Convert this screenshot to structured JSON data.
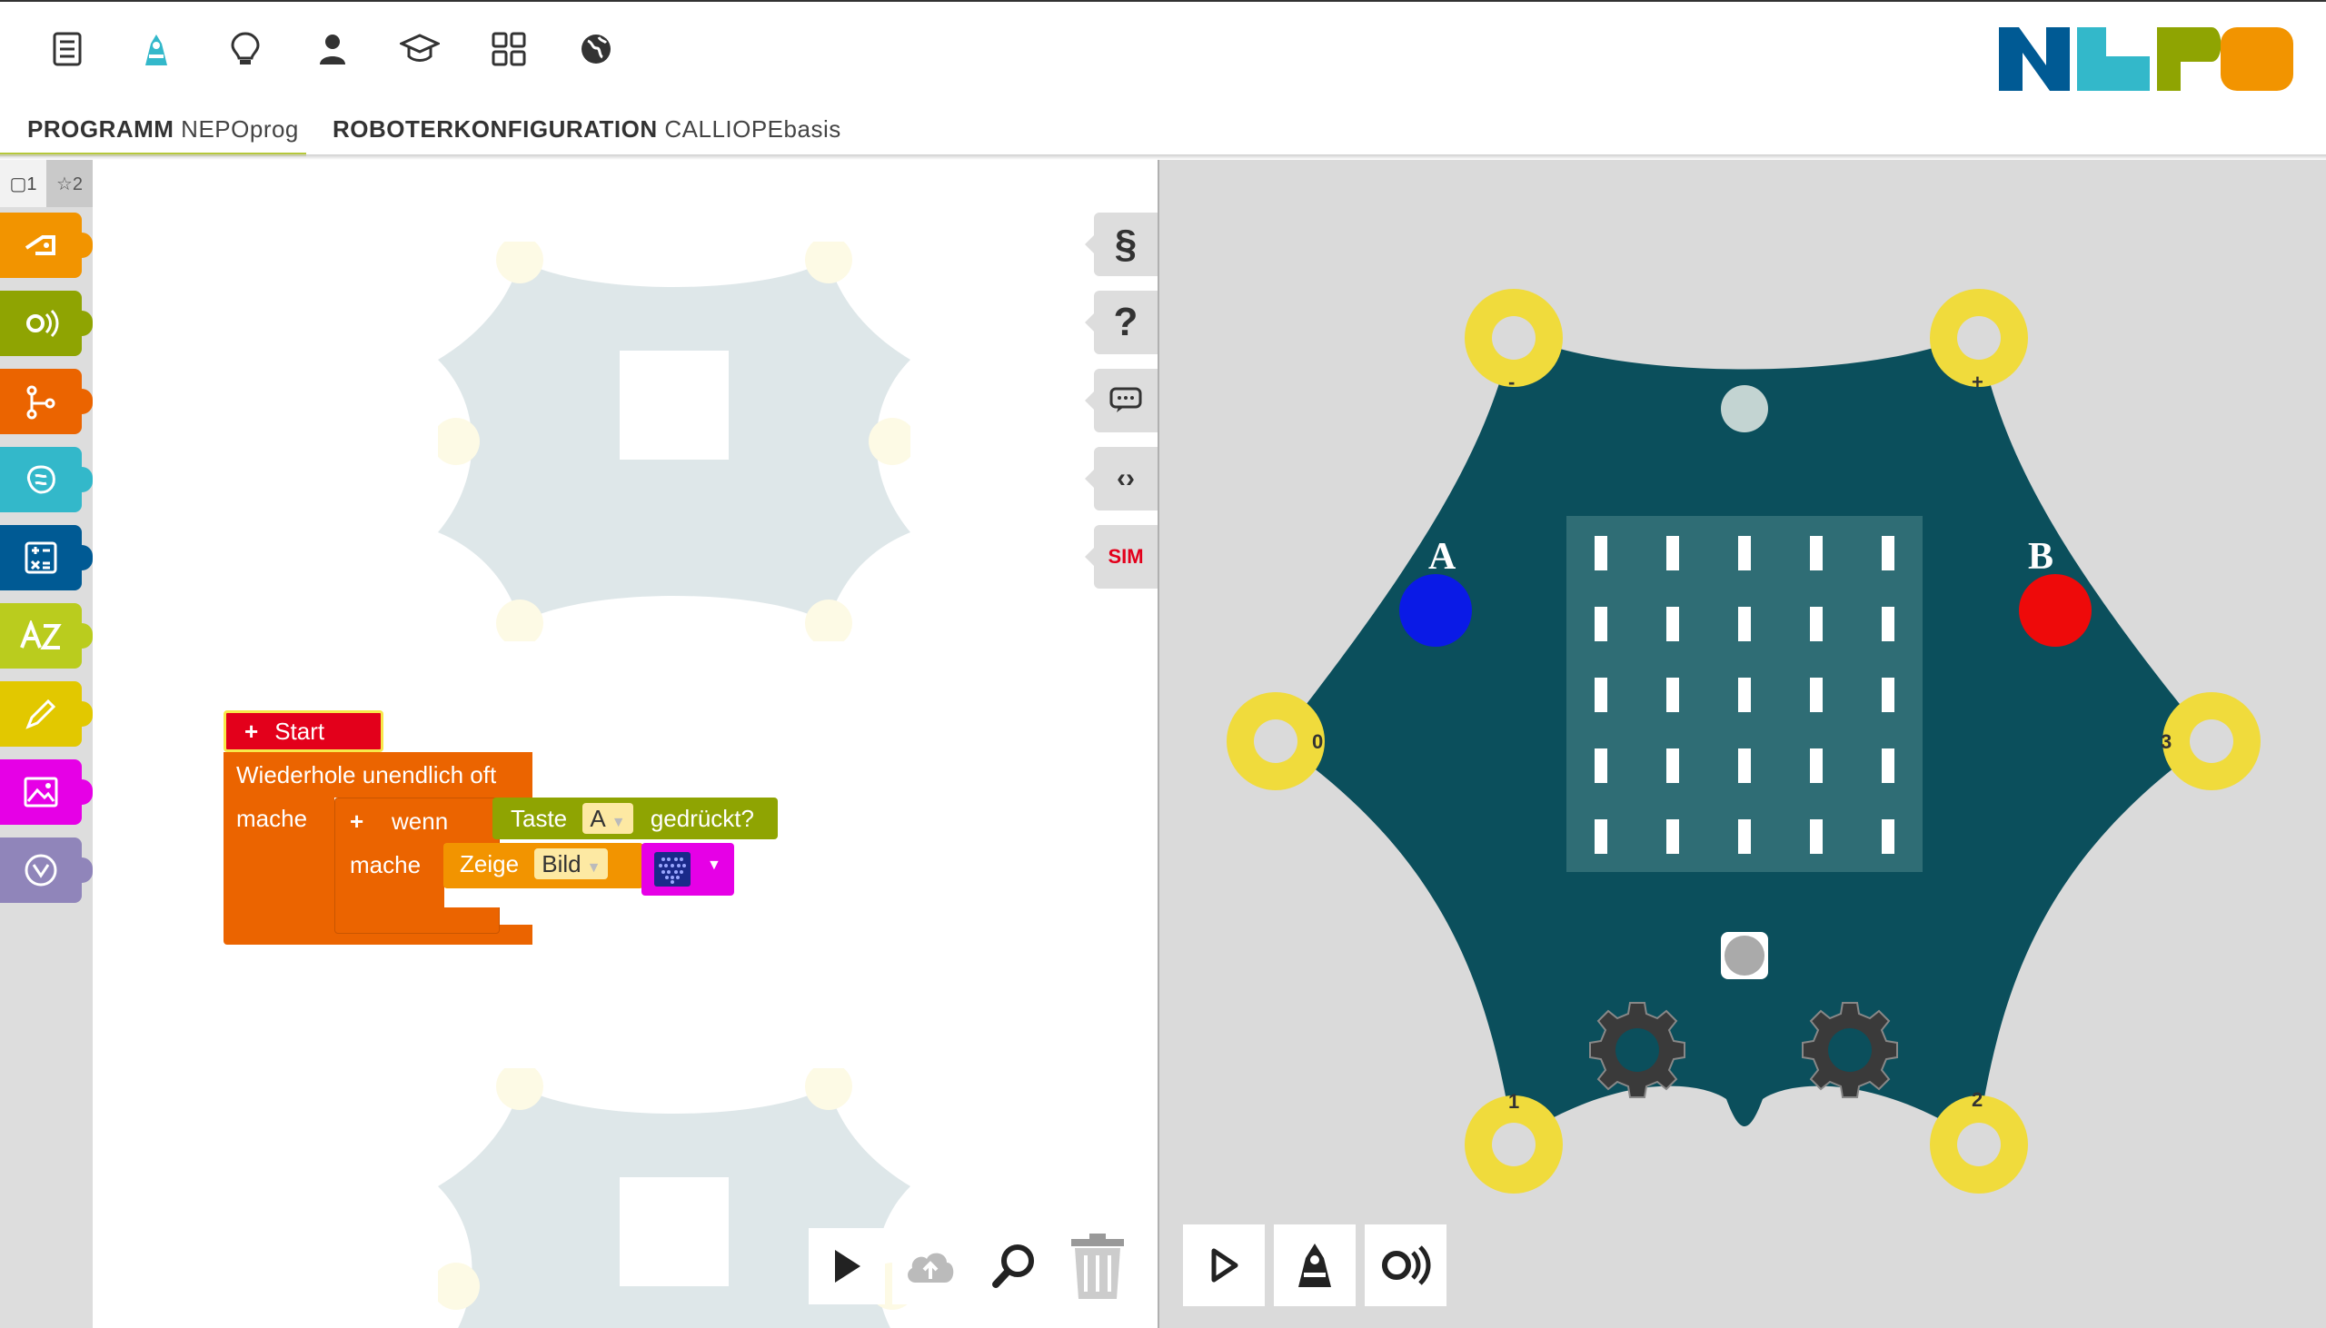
{
  "tabs": {
    "program": {
      "label": "PROGRAMM",
      "value": "NEPOprog"
    },
    "robot": {
      "label": "ROBOTERKONFIGURATION",
      "value": "CALLIOPEbasis"
    }
  },
  "topnav_icons": [
    "menu-icon",
    "robot-icon",
    "lightbulb-icon",
    "user-icon",
    "graduation-cap-icon",
    "gallery-grid-icon",
    "globe-icon"
  ],
  "logo_colors": [
    "#005a94",
    "#33b8ca",
    "#8fa402",
    "#f29400"
  ],
  "toolbox": {
    "levels": [
      "▢1",
      "☆2"
    ],
    "categories": [
      {
        "name": "action",
        "color": "#f29400"
      },
      {
        "name": "sensors",
        "color": "#8fa402"
      },
      {
        "name": "control",
        "color": "#eb6400"
      },
      {
        "name": "logic",
        "color": "#33b8ca"
      },
      {
        "name": "math",
        "color": "#005a94"
      },
      {
        "name": "text",
        "color": "#bacc1e"
      },
      {
        "name": "colours",
        "color": "#e2c800"
      },
      {
        "name": "images",
        "color": "#e600e6"
      },
      {
        "name": "variables",
        "color": "#9085ba"
      }
    ]
  },
  "side_buttons": {
    "sim_label": "SIM"
  },
  "blocks": {
    "start": "Start",
    "repeat": "Wiederhole unendlich oft",
    "do": "mache",
    "if": "wenn",
    "do_inner": "mache",
    "key": "Taste",
    "key_value": "A",
    "pressed": "gedrückt?",
    "show": "Zeige",
    "show_value": "Bild"
  },
  "simulator": {
    "button_a_label": "A",
    "button_b_label": "B",
    "pin_labels": {
      "minus": "-",
      "plus": "+",
      "p0": "0",
      "p3": "3",
      "p1": "1",
      "p2": "2"
    },
    "led_matrix": {
      "rows": 5,
      "cols": 5
    },
    "colors": {
      "board": "#0b4f5c",
      "pads": "#f0db3c",
      "button_a": "#0a1ae6",
      "button_b": "#ee0a0a",
      "sim_bg": "#dadada"
    }
  }
}
